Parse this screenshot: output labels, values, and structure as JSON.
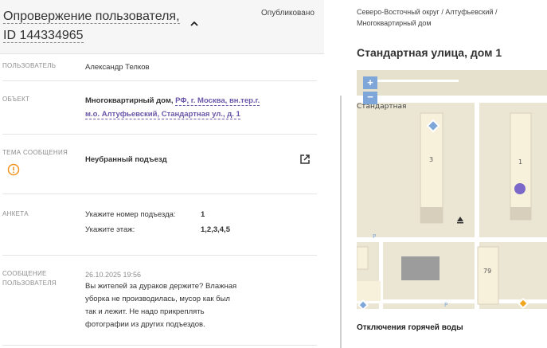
{
  "header": {
    "title": "Опровержение пользователя, ID 144334965",
    "status": "Опубликовано"
  },
  "user": {
    "label": "ПОЛЬЗОВАТЕЛЬ",
    "name": "Александр Телков"
  },
  "object": {
    "label": "ОБЪЕКТ",
    "type": "Многоквартирный дом,",
    "address_line1": "РФ, г. Москва, вн.тер.г.",
    "address_line2": "м.о. Алтуфьевский, Стандартная ул., д. 1"
  },
  "topic": {
    "label": "ТЕМА СООБЩЕНИЯ",
    "value": "Неубранный подъезд"
  },
  "survey": {
    "label": "АНКЕТА",
    "rows": [
      {
        "question": "Укажите номер подъезда:",
        "answer": "1"
      },
      {
        "question": "Укажите этаж:",
        "answer": "1,2,3,4,5"
      }
    ]
  },
  "message": {
    "label_line1": "СООБЩЕНИЕ",
    "label_line2": "ПОЛЬЗОВАТЕЛЯ",
    "date": "26.10.2025 19:56",
    "lines": [
      "Вы жителей за дураков держите? Влажная",
      "уборка не производилась, мусор как был",
      "так и лежит. Не надо прикреплять",
      "фотографии из других подъездов."
    ]
  },
  "sidebar": {
    "breadcrumb_line1": "Северо-Восточный округ / Алтуфьевский /",
    "breadcrumb_line2": "Многоквартирный дом",
    "address_title": "Стандартная улица, дом 1",
    "map": {
      "zoom_in": "+",
      "zoom_out": "−",
      "street_label": "Стандартная",
      "building_3": "3",
      "building_1": "1",
      "building_79": "79",
      "parking": "P"
    },
    "outage_title": "Отключения горячей воды"
  },
  "colors": {
    "accent": "#6a56a8",
    "warning": "#f0941e",
    "map_marker": "#7b68c8"
  }
}
